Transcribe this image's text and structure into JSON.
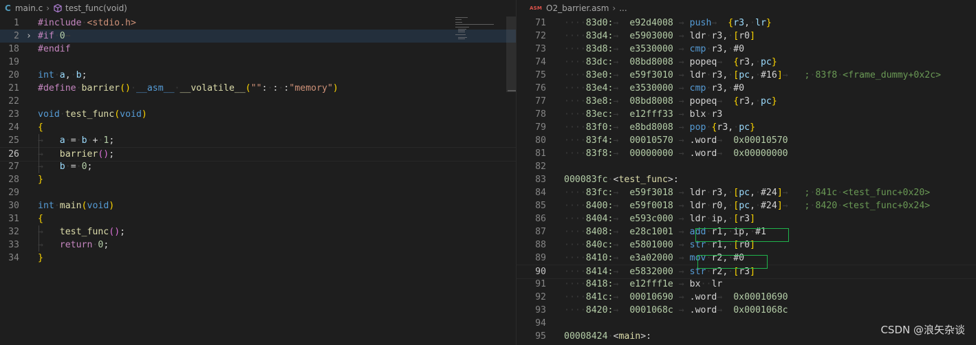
{
  "left_editor": {
    "breadcrumb": {
      "lang_badge": "C",
      "file": "main.c",
      "separator": "›",
      "symbol": "test_func(void)"
    },
    "lines": [
      {
        "n": "1",
        "html": "<span class=\"pp\">#include</span><span class=\"ws\">·</span><span class=\"str\">&lt;stdio.h&gt;</span>"
      },
      {
        "n": "2",
        "html": "<span class=\"pp\">#if</span><span class=\"ws\">·</span><span class=\"num\">0</span><span class=\"ws\">⋯</span>"
      },
      {
        "n": "18",
        "html": "<span class=\"pp\">#endif</span>"
      },
      {
        "n": "19",
        "html": ""
      },
      {
        "n": "20",
        "html": "<span class=\"kw\">int</span><span class=\"ws\">·</span><span class=\"var\">a</span>,<span class=\"ws\">·</span><span class=\"var\">b</span>;"
      },
      {
        "n": "21",
        "html": "<span class=\"pp\">#define</span><span class=\"ws\">·</span><span class=\"fn\">barrier</span><span class=\"br1\">()</span><span class=\"ws\">·</span><span class=\"kw\">__asm__</span><span class=\"ws\">·</span><span class=\"fn\">__volatile__</span><span class=\"br1\">(</span><span class=\"str\">\"\"</span>:<span class=\"ws\">·</span>:<span class=\"ws\">·</span>:<span class=\"str\">\"memory\"</span><span class=\"br1\">)</span>"
      },
      {
        "n": "22",
        "html": ""
      },
      {
        "n": "23",
        "html": "<span class=\"kw\">void</span><span class=\"ws\">·</span><span class=\"fn\">test_func</span><span class=\"br1\">(</span><span class=\"kw\">void</span><span class=\"br1\">)</span>"
      },
      {
        "n": "24",
        "html": "<span class=\"br1\">{</span>"
      },
      {
        "n": "25",
        "html": "<span class=\"ws\">→</span><span class=\"ws\">   </span><span class=\"var\">a</span><span class=\"ws\">·</span>=<span class=\"ws\">·</span><span class=\"var\">b</span><span class=\"ws\">·</span>+<span class=\"ws\">·</span><span class=\"num\">1</span>;"
      },
      {
        "n": "26",
        "html": "<span class=\"ws\">→</span><span class=\"ws\">   </span><span class=\"fn\">barrier</span><span class=\"br2\">()</span>;"
      },
      {
        "n": "27",
        "html": "<span class=\"ws\">→</span><span class=\"ws\">   </span><span class=\"var\">b</span><span class=\"ws\">·</span>=<span class=\"ws\">·</span><span class=\"num\">0</span>;"
      },
      {
        "n": "28",
        "html": "<span class=\"br1\">}</span>"
      },
      {
        "n": "29",
        "html": ""
      },
      {
        "n": "30",
        "html": "<span class=\"kw\">int</span><span class=\"ws\">·</span><span class=\"fn\">main</span><span class=\"br1\">(</span><span class=\"kw\">void</span><span class=\"br1\">)</span>"
      },
      {
        "n": "31",
        "html": "<span class=\"br1\">{</span>"
      },
      {
        "n": "32",
        "html": "<span class=\"ws\">→</span><span class=\"ws\">   </span><span class=\"fn\">test_func</span><span class=\"br2\">()</span>;"
      },
      {
        "n": "33",
        "html": "<span class=\"ws\">→</span><span class=\"ws\">   </span><span class=\"pp\">return</span><span class=\"ws\">·</span><span class=\"num\">0</span>;"
      },
      {
        "n": "34",
        "html": "<span class=\"br1\">}</span>"
      }
    ],
    "active_line": "26",
    "folded_line": "2"
  },
  "right_editor": {
    "breadcrumb": {
      "badge": "ASM",
      "file": "O2_barrier.asm",
      "separator": "›",
      "ellipsis": "..."
    },
    "lines": [
      {
        "n": "71",
        "html": "<span class=\"ws\">····</span><span class=\"hex\">83d0:</span><span class=\"ws\">→</span><span class=\"ws\">  </span><span class=\"hex\">e92d4008</span><span class=\"ws\"> → </span><span class=\"kw\">push</span><span class=\"ws\">→</span><span class=\"ws\">  </span><span class=\"br1\">{</span><span class=\"var\">r3</span>,<span class=\"ws\">·</span><span class=\"var\">lr</span><span class=\"br1\">}</span>"
      },
      {
        "n": "72",
        "html": "<span class=\"ws\">····</span><span class=\"hex\">83d4:</span><span class=\"ws\">→</span><span class=\"ws\">  </span><span class=\"hex\">e5903000</span><span class=\"ws\"> → </span>ldr<span class=\"ws\">·</span>r3,<span class=\"ws\">·</span><span class=\"br1\">[</span>r0<span class=\"br1\">]</span>"
      },
      {
        "n": "73",
        "html": "<span class=\"ws\">····</span><span class=\"hex\">83d8:</span><span class=\"ws\">→</span><span class=\"ws\">  </span><span class=\"hex\">e3530000</span><span class=\"ws\"> → </span><span class=\"kw\">cmp</span><span class=\"ws\">·</span>r3,<span class=\"ws\">·</span>#0"
      },
      {
        "n": "74",
        "html": "<span class=\"ws\">····</span><span class=\"hex\">83dc:</span><span class=\"ws\">→</span><span class=\"ws\">  </span><span class=\"hex\">08bd8008</span><span class=\"ws\"> → </span>popeq<span class=\"ws\">→</span><span class=\"ws\">  </span><span class=\"br1\">{</span>r3,<span class=\"ws\">·</span><span class=\"var\">pc</span><span class=\"br1\">}</span>"
      },
      {
        "n": "75",
        "html": "<span class=\"ws\">····</span><span class=\"hex\">83e0:</span><span class=\"ws\">→</span><span class=\"ws\">  </span><span class=\"hex\">e59f3010</span><span class=\"ws\"> → </span>ldr<span class=\"ws\">·</span>r3,<span class=\"ws\">·</span><span class=\"br1\">[</span><span class=\"var\">pc</span>,<span class=\"ws\">·</span>#16<span class=\"br1\">]</span><span class=\"ws\">→ </span><span class=\"ws\">  </span><span class=\"cmt\">;<span class=\"ws\">·</span>83f8<span class=\"ws\">·</span>&lt;frame_dummy+0x2c&gt;</span>"
      },
      {
        "n": "76",
        "html": "<span class=\"ws\">····</span><span class=\"hex\">83e4:</span><span class=\"ws\">→</span><span class=\"ws\">  </span><span class=\"hex\">e3530000</span><span class=\"ws\"> → </span><span class=\"kw\">cmp</span><span class=\"ws\">·</span>r3,<span class=\"ws\">·</span>#0"
      },
      {
        "n": "77",
        "html": "<span class=\"ws\">····</span><span class=\"hex\">83e8:</span><span class=\"ws\">→</span><span class=\"ws\">  </span><span class=\"hex\">08bd8008</span><span class=\"ws\"> → </span>popeq<span class=\"ws\">→</span><span class=\"ws\">  </span><span class=\"br1\">{</span>r3,<span class=\"ws\">·</span><span class=\"var\">pc</span><span class=\"br1\">}</span>"
      },
      {
        "n": "78",
        "html": "<span class=\"ws\">····</span><span class=\"hex\">83ec:</span><span class=\"ws\">→</span><span class=\"ws\">  </span><span class=\"hex\">e12fff33</span><span class=\"ws\"> → </span>blx<span class=\"ws\">·</span>r3"
      },
      {
        "n": "79",
        "html": "<span class=\"ws\">····</span><span class=\"hex\">83f0:</span><span class=\"ws\">→</span><span class=\"ws\">  </span><span class=\"hex\">e8bd8008</span><span class=\"ws\"> → </span><span class=\"kw\">pop</span><span class=\"ws\">·</span><span class=\"br1\">{</span>r3,<span class=\"ws\">·</span><span class=\"var\">pc</span><span class=\"br1\">}</span>"
      },
      {
        "n": "80",
        "html": "<span class=\"ws\">····</span><span class=\"hex\">83f4:</span><span class=\"ws\">→</span><span class=\"ws\">  </span><span class=\"hex\">00010570</span><span class=\"ws\"> → </span>.word<span class=\"ws\">→</span><span class=\"ws\">  </span><span class=\"hex\">0x00010570</span>"
      },
      {
        "n": "81",
        "html": "<span class=\"ws\">····</span><span class=\"hex\">83f8:</span><span class=\"ws\">→</span><span class=\"ws\">  </span><span class=\"hex\">00000000</span><span class=\"ws\"> → </span>.word<span class=\"ws\">→</span><span class=\"ws\">  </span><span class=\"hex\">0x00000000</span>"
      },
      {
        "n": "82",
        "html": ""
      },
      {
        "n": "83",
        "html": "<span class=\"hex\">000083fc</span><span class=\"ws\">·</span>&lt;<span class=\"lab\">test_func</span>&gt;:"
      },
      {
        "n": "84",
        "html": "<span class=\"ws\">····</span><span class=\"hex\">83fc:</span><span class=\"ws\">→</span><span class=\"ws\">  </span><span class=\"hex\">e59f3018</span><span class=\"ws\"> → </span>ldr<span class=\"ws\">·</span>r3,<span class=\"ws\">·</span><span class=\"br1\">[</span><span class=\"var\">pc</span>,<span class=\"ws\">·</span>#24<span class=\"br1\">]</span><span class=\"ws\">→ </span><span class=\"ws\">  </span><span class=\"cmt\">;<span class=\"ws\">·</span>841c<span class=\"ws\">·</span>&lt;test_func+0x20&gt;</span>"
      },
      {
        "n": "85",
        "html": "<span class=\"ws\">····</span><span class=\"hex\">8400:</span><span class=\"ws\">→</span><span class=\"ws\">  </span><span class=\"hex\">e59f0018</span><span class=\"ws\"> → </span>ldr<span class=\"ws\">·</span>r0,<span class=\"ws\">·</span><span class=\"br1\">[</span><span class=\"var\">pc</span>,<span class=\"ws\">·</span>#24<span class=\"br1\">]</span><span class=\"ws\">→ </span><span class=\"ws\">  </span><span class=\"cmt\">;<span class=\"ws\">·</span>8420<span class=\"ws\">·</span>&lt;test_func+0x24&gt;</span>"
      },
      {
        "n": "86",
        "html": "<span class=\"ws\">····</span><span class=\"hex\">8404:</span><span class=\"ws\">→</span><span class=\"ws\">  </span><span class=\"hex\">e593c000</span><span class=\"ws\"> → </span>ldr<span class=\"ws\">·</span>ip,<span class=\"ws\">·</span><span class=\"br1\">[</span>r3<span class=\"br1\">]</span>"
      },
      {
        "n": "87",
        "html": "<span class=\"ws\">····</span><span class=\"hex\">8408:</span><span class=\"ws\">→</span><span class=\"ws\">  </span><span class=\"hex\">e28c1001</span><span class=\"ws\"> → </span><span class=\"kw\">add</span><span class=\"ws\">·</span>r1,<span class=\"ws\">·</span>ip,<span class=\"ws\">·</span>#1"
      },
      {
        "n": "88",
        "html": "<span class=\"ws\">····</span><span class=\"hex\">840c:</span><span class=\"ws\">→</span><span class=\"ws\">  </span><span class=\"hex\">e5801000</span><span class=\"ws\"> → </span><span class=\"kw\">str</span><span class=\"ws\">·</span>r1,<span class=\"ws\">·</span><span class=\"br1\">[</span>r0<span class=\"br1\">]</span>"
      },
      {
        "n": "89",
        "html": "<span class=\"ws\">····</span><span class=\"hex\">8410:</span><span class=\"ws\">→</span><span class=\"ws\">  </span><span class=\"hex\">e3a02000</span><span class=\"ws\"> → </span><span class=\"kw\">mov</span><span class=\"ws\">·</span>r2,<span class=\"ws\">·</span>#0"
      },
      {
        "n": "90",
        "html": "<span class=\"ws\">····</span><span class=\"hex\">8414:</span><span class=\"ws\">→</span><span class=\"ws\">  </span><span class=\"hex\">e5832000</span><span class=\"ws\"> → </span><span class=\"kw\">str</span><span class=\"ws\">·</span>r2,<span class=\"ws\">·</span><span class=\"br1\">[</span>r3<span class=\"br1\">]</span>"
      },
      {
        "n": "91",
        "html": "<span class=\"ws\">····</span><span class=\"hex\">8418:</span><span class=\"ws\">→</span><span class=\"ws\">  </span><span class=\"hex\">e12fff1e</span><span class=\"ws\"> → </span>bx<span class=\"ws\">··</span>lr"
      },
      {
        "n": "92",
        "html": "<span class=\"ws\">····</span><span class=\"hex\">841c:</span><span class=\"ws\">→</span><span class=\"ws\">  </span><span class=\"hex\">00010690</span><span class=\"ws\"> → </span>.word<span class=\"ws\">→</span><span class=\"ws\">  </span><span class=\"hex\">0x00010690</span>"
      },
      {
        "n": "93",
        "html": "<span class=\"ws\">····</span><span class=\"hex\">8420:</span><span class=\"ws\">→</span><span class=\"ws\">  </span><span class=\"hex\">0001068c</span><span class=\"ws\"> → </span>.word<span class=\"ws\">→</span><span class=\"ws\">  </span><span class=\"hex\">0x0001068c</span>"
      },
      {
        "n": "94",
        "html": ""
      },
      {
        "n": "95",
        "html": "<span class=\"hex\">00008424</span><span class=\"ws\">·</span>&lt;<span class=\"lab\">main</span>&gt;:"
      }
    ],
    "active_line": "90",
    "highlighted_lines": [
      "87",
      "89"
    ]
  },
  "watermark": "CSDN @浪矢杂谈",
  "colors": {
    "background": "#1e1e1e",
    "highlight_box": "#1fb34c",
    "keyword": "#569cd6",
    "preprocessor": "#c586c0",
    "string": "#ce9178",
    "number": "#b5cea8",
    "comment": "#6a9955"
  },
  "icons": {
    "fold": "chevron-right-icon",
    "symbol": "function-cube-icon"
  }
}
